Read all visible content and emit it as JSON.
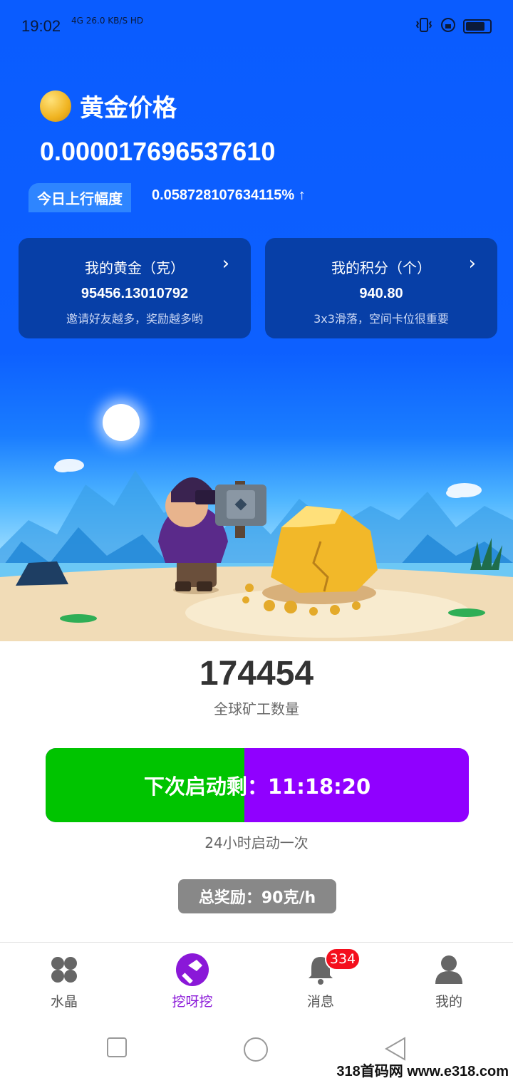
{
  "status_bar": {
    "time": "19:02",
    "network": "4G",
    "speed": "26.0 KB/S",
    "hd": "HD"
  },
  "header": {
    "title": "黄金价格",
    "price": "0.000017696537610",
    "rise_label": "今日上行幅度",
    "rise_value": "0.058728107634115%",
    "rise_arrow": "↑"
  },
  "cards": [
    {
      "title": "我的黄金（克）",
      "value": "95456.13010792",
      "subtitle": "邀请好友越多，奖励越多哟",
      "chevron": "›"
    },
    {
      "title": "我的积分（个）",
      "value": "940.80",
      "subtitle": "3x3滑落，空间卡位很重要",
      "chevron": "›"
    }
  ],
  "miners": {
    "count": "174454",
    "label": "全球矿工数量"
  },
  "start": {
    "label": "下次启动剩：11:18:20",
    "progress": 0.47,
    "note": "24小时启动一次"
  },
  "reward": {
    "label": "总奖励：90克/h"
  },
  "tabs": [
    {
      "label": "水晶",
      "icon": "clover-icon"
    },
    {
      "label": "挖呀挖",
      "icon": "pickaxe-icon"
    },
    {
      "label": "消息",
      "icon": "bell-icon"
    },
    {
      "label": "我的",
      "icon": "user-icon"
    }
  ],
  "badge": "334",
  "watermark": "318首码网 www.e318.com",
  "colors": {
    "primary_blue": "#0d60ff",
    "card_blue": "#073fa7",
    "progress_green": "#00c400",
    "progress_purple": "#9000ff",
    "active_tab": "#8a18d8",
    "badge_red": "#f40f1d"
  }
}
